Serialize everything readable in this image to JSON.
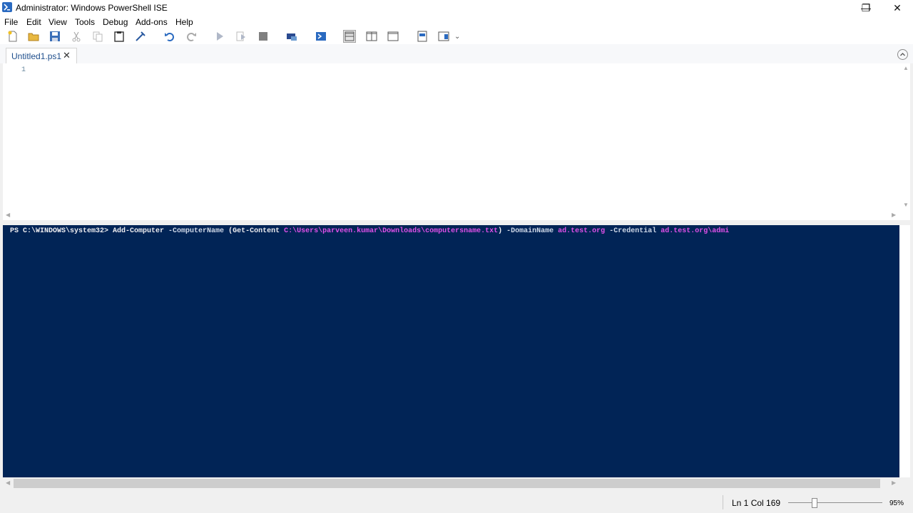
{
  "window": {
    "title": "Administrator: Windows PowerShell ISE",
    "controls": {
      "minimize": "—",
      "restore": "❐",
      "close": "✕"
    }
  },
  "menu": [
    "File",
    "Edit",
    "View",
    "Tools",
    "Debug",
    "Add-ons",
    "Help"
  ],
  "toolbar": {
    "icons": [
      "new-icon",
      "open-icon",
      "save-icon",
      "cut-icon",
      "copy-icon",
      "paste-icon",
      "clear-icon",
      "undo-icon",
      "redo-icon",
      "run-icon",
      "run-selection-icon",
      "stop-icon",
      "new-remote-tab-icon",
      "start-powershell-icon",
      "layout-top-icon",
      "layout-right-icon",
      "layout-max-icon",
      "show-commands-icon",
      "show-addon-icon",
      "customize-icon"
    ],
    "overflow": "⌄"
  },
  "tab": {
    "label": "Untitled1.ps1",
    "close": "✕"
  },
  "editor": {
    "line_numbers": [
      "1"
    ]
  },
  "console": {
    "prompt": "PS C:\\WINDOWS\\system32> ",
    "cmdlet": "Add-Computer",
    "param1": " -ComputerName ",
    "paren_open": "(Get-Content ",
    "path": "C:\\Users\\parveen.kumar\\Downloads\\computersname.txt",
    "paren_close": ")",
    "param2": " -DomainName ",
    "domain": "ad.test.org",
    "param3": " -Credential ",
    "credential": "ad.test.org\\admi"
  },
  "status": {
    "position": "Ln 1  Col 169",
    "zoom": "95%",
    "zoom_level": 0.28
  },
  "colors": {
    "console_bg": "#012456",
    "string": "#e050e8"
  }
}
